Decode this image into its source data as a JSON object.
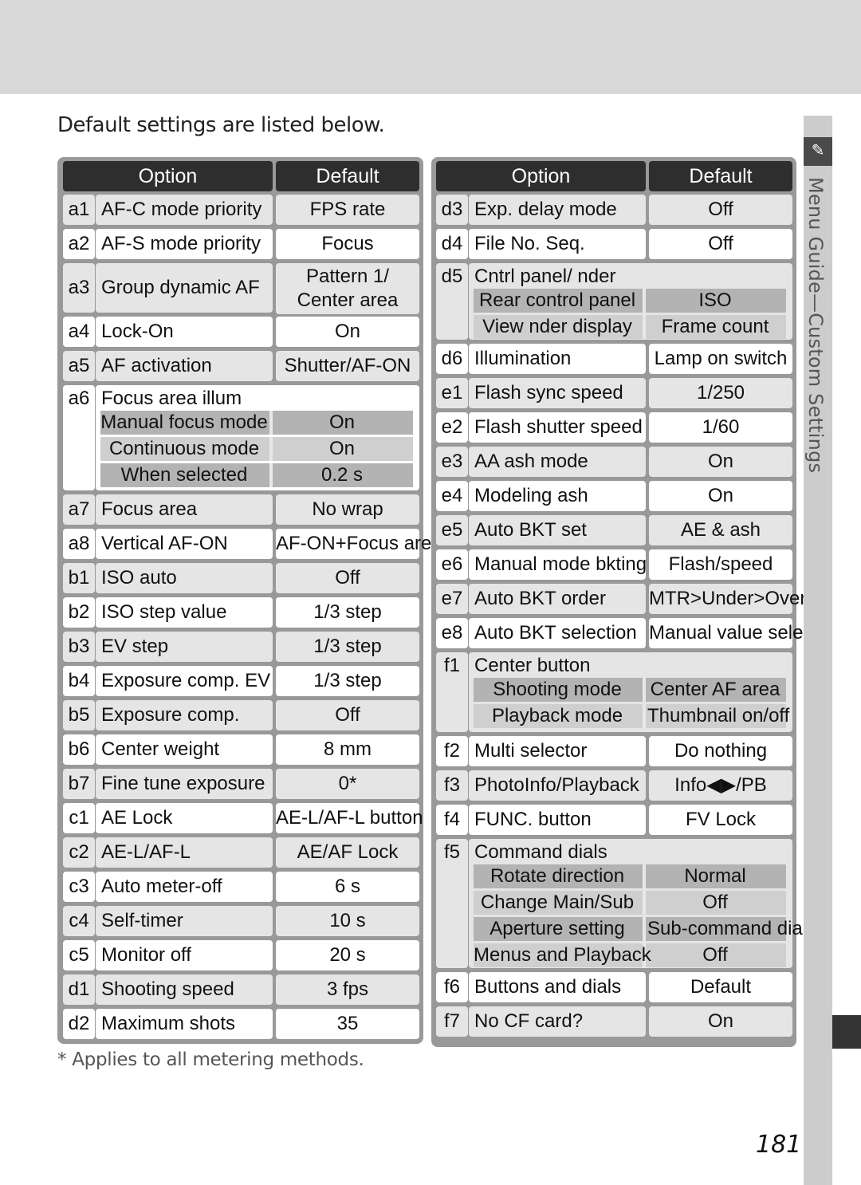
{
  "header_band": "",
  "intro": "Default settings are listed below.",
  "footnote": "* Applies to all metering methods.",
  "page_number": "181",
  "side_tab": {
    "icon": "pencil-menu-icon",
    "text": "Menu Guide—Custom Settings"
  },
  "left_table": {
    "headers": {
      "option": "Option",
      "default": "Default"
    },
    "rows": [
      {
        "code": "a1",
        "option": "AF-C mode priority",
        "default": "FPS rate"
      },
      {
        "code": "a2",
        "option": "AF-S mode priority",
        "default": "Focus"
      },
      {
        "code": "a3",
        "option": "Group dynamic AF",
        "default": "Pattern 1/",
        "default2": "Center area"
      },
      {
        "code": "a4",
        "option": "Lock-On",
        "default": "On"
      },
      {
        "code": "a5",
        "option": "AF activation",
        "default": "Shutter/AF-ON"
      },
      {
        "code": "a6",
        "option": "Focus area illum",
        "sub": [
          {
            "option": "Manual focus mode",
            "default": "On"
          },
          {
            "option": "Continuous mode",
            "default": "On"
          },
          {
            "option": "When selected",
            "default": "0.2 s"
          }
        ]
      },
      {
        "code": "a7",
        "option": "Focus area",
        "default": "No wrap"
      },
      {
        "code": "a8",
        "option": "Vertical AF-ON",
        "default": "AF-ON+Focus are..."
      },
      {
        "code": "b1",
        "option": "ISO auto",
        "default": "Off"
      },
      {
        "code": "b2",
        "option": "ISO step value",
        "default": "1/3 step"
      },
      {
        "code": "b3",
        "option": "EV step",
        "default": "1/3 step"
      },
      {
        "code": "b4",
        "option": "Exposure comp. EV",
        "default": "1/3 step"
      },
      {
        "code": "b5",
        "option": "Exposure comp.",
        "default": "Off"
      },
      {
        "code": "b6",
        "option": "Center weight",
        "default": "8 mm"
      },
      {
        "code": "b7",
        "option": "Fine tune exposure",
        "default": "0*"
      },
      {
        "code": "c1",
        "option": "AE Lock",
        "default": "AE-L/AF-L button"
      },
      {
        "code": "c2",
        "option": "AE-L/AF-L",
        "default": "AE/AF Lock"
      },
      {
        "code": "c3",
        "option": "Auto meter-off",
        "default": "6 s"
      },
      {
        "code": "c4",
        "option": "Self-timer",
        "default": "10 s"
      },
      {
        "code": "c5",
        "option": "Monitor off",
        "default": "20 s"
      },
      {
        "code": "d1",
        "option": "Shooting speed",
        "default": "3 fps"
      },
      {
        "code": "d2",
        "option": "Maximum shots",
        "default": "35"
      }
    ]
  },
  "right_table": {
    "headers": {
      "option": "Option",
      "default": "Default"
    },
    "rows": [
      {
        "code": "d3",
        "option": "Exp. delay mode",
        "default": "Off"
      },
      {
        "code": "d4",
        "option": "File No. Seq.",
        "default": "Off"
      },
      {
        "code": "d5",
        "option": "Cntrl panel/ nder",
        "sub": [
          {
            "option": "Rear control panel",
            "default": "ISO"
          },
          {
            "option": "View nder display",
            "default": "Frame count"
          }
        ]
      },
      {
        "code": "d6",
        "option": "Illumination",
        "default": "Lamp on switch"
      },
      {
        "code": "e1",
        "option": "Flash sync speed",
        "default": "1/250"
      },
      {
        "code": "e2",
        "option": "Flash shutter speed",
        "default": "1/60"
      },
      {
        "code": "e3",
        "option": "AA  ash mode",
        "default": "On"
      },
      {
        "code": "e4",
        "option": "Modeling  ash",
        "default": "On"
      },
      {
        "code": "e5",
        "option": "Auto BKT set",
        "default": "AE &  ash"
      },
      {
        "code": "e6",
        "option": "Manual mode bkting",
        "default": "Flash/speed"
      },
      {
        "code": "e7",
        "option": "Auto BKT order",
        "default": "MTR>Under>Over"
      },
      {
        "code": "e8",
        "option": "Auto BKT selection",
        "default": "Manual value select"
      },
      {
        "code": "f1",
        "option": "Center button",
        "sub": [
          {
            "option": "Shooting mode",
            "default": "Center AF area"
          },
          {
            "option": "Playback mode",
            "default": "Thumbnail on/off"
          }
        ]
      },
      {
        "code": "f2",
        "option": "Multi selector",
        "default": "Do nothing"
      },
      {
        "code": "f3",
        "option": "PhotoInfo/Playback",
        "default": "Info◀▶/PB"
      },
      {
        "code": "f4",
        "option": "FUNC. button",
        "default": "FV Lock"
      },
      {
        "code": "f5",
        "option": "Command dials",
        "sub": [
          {
            "option": "Rotate direction",
            "default": "Normal"
          },
          {
            "option": "Change Main/Sub",
            "default": "Off"
          },
          {
            "option": "Aperture setting",
            "default": "Sub-command dial"
          },
          {
            "option": "Menus and Playback",
            "default": "Off"
          }
        ]
      },
      {
        "code": "f6",
        "option": "Buttons and dials",
        "default": "Default"
      },
      {
        "code": "f7",
        "option": "No CF card?",
        "default": "On"
      }
    ]
  }
}
